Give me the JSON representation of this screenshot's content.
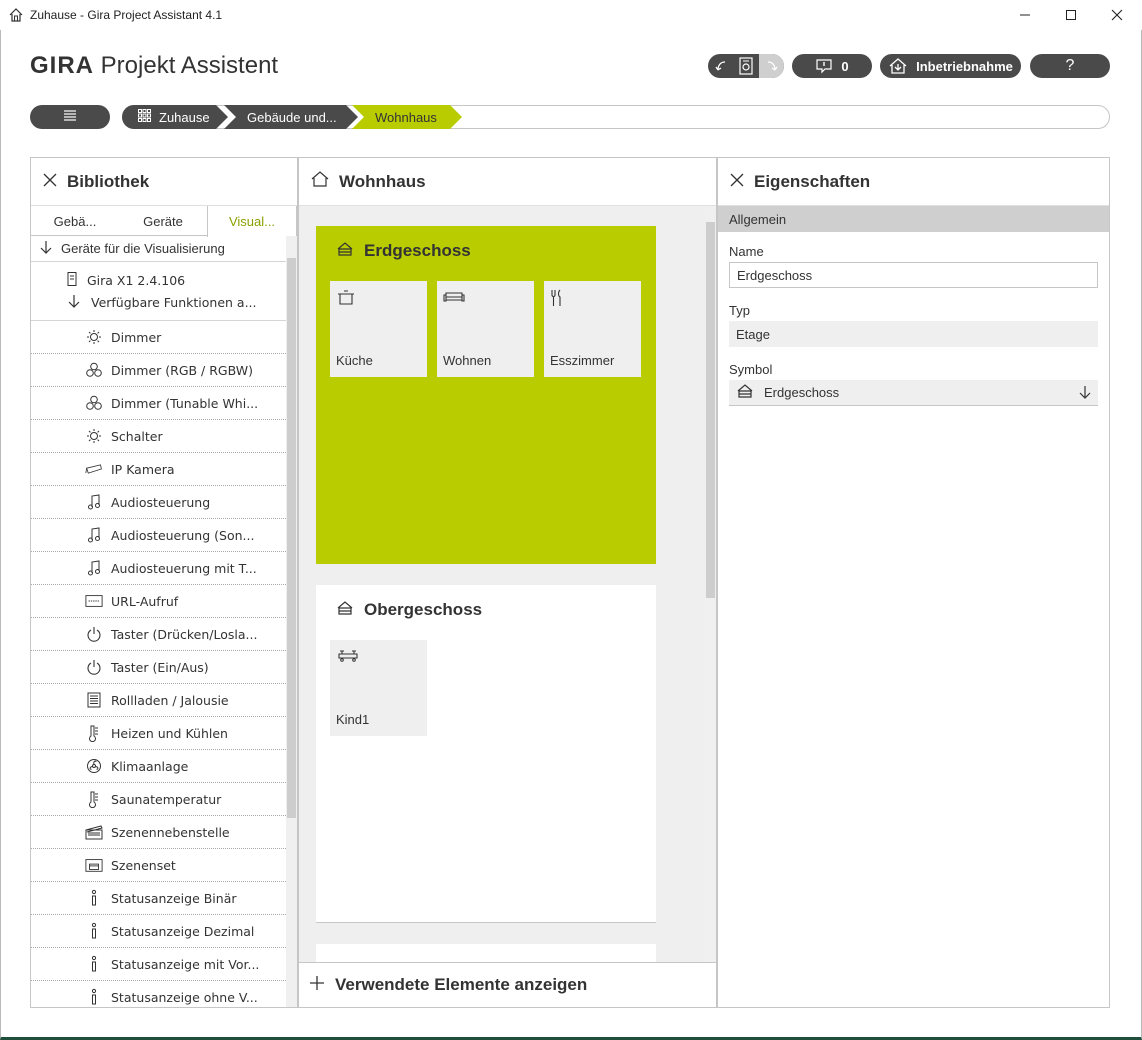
{
  "window": {
    "title": "Zuhause - Gira Project Assistant 4.1",
    "controls": [
      "minimize",
      "maximize",
      "close"
    ]
  },
  "brand": {
    "bold": "GIRA",
    "rest": "Projekt Assistent"
  },
  "toolbar": {
    "messages_count": "0",
    "commission_label": "Inbetriebnahme",
    "help_label": "?"
  },
  "breadcrumb": {
    "items": [
      "Zuhause",
      "Gebäude und...",
      "Wohnhaus"
    ]
  },
  "library": {
    "title": "Bibliothek",
    "tabs": [
      "Gebä...",
      "Geräte",
      "Visual..."
    ],
    "active_tab": "Visual...",
    "root_label": "Geräte für die Visualisierung",
    "device_name": "Gira X1 2.4.106",
    "device_sub": "Verfügbare Funktionen a...",
    "functions": [
      {
        "label": "Dimmer",
        "icon": "bulb-icon"
      },
      {
        "label": "Dimmer (RGB / RGBW)",
        "icon": "rgb-icon"
      },
      {
        "label": "Dimmer (Tunable Whi...",
        "icon": "rgb-icon"
      },
      {
        "label": "Schalter",
        "icon": "bulb-icon"
      },
      {
        "label": "IP Kamera",
        "icon": "camera-icon"
      },
      {
        "label": "Audiosteuerung",
        "icon": "music-icon"
      },
      {
        "label": "Audiosteuerung (Son...",
        "icon": "music-icon"
      },
      {
        "label": "Audiosteuerung mit T...",
        "icon": "music-icon"
      },
      {
        "label": "URL-Aufruf",
        "icon": "www-icon"
      },
      {
        "label": "Taster (Drücken/Losla...",
        "icon": "power-icon"
      },
      {
        "label": "Taster (Ein/Aus)",
        "icon": "power-icon"
      },
      {
        "label": "Rollladen / Jalousie",
        "icon": "blind-icon"
      },
      {
        "label": "Heizen und Kühlen",
        "icon": "thermometer-icon"
      },
      {
        "label": "Klimaanlage",
        "icon": "fan-icon"
      },
      {
        "label": "Saunatemperatur",
        "icon": "thermometer-icon"
      },
      {
        "label": "Szenennebenstelle",
        "icon": "clapper-icon"
      },
      {
        "label": "Szenenset",
        "icon": "sceneset-icon"
      },
      {
        "label": "Statusanzeige Binär",
        "icon": "info-icon"
      },
      {
        "label": "Statusanzeige Dezimal",
        "icon": "info-icon"
      },
      {
        "label": "Statusanzeige mit Vor...",
        "icon": "info-icon"
      },
      {
        "label": "Statusanzeige ohne V...",
        "icon": "info-icon"
      }
    ]
  },
  "center": {
    "title": "Wohnhaus",
    "floors": [
      {
        "name": "Erdgeschoss",
        "rooms": [
          {
            "name": "Küche",
            "icon": "pot-icon"
          },
          {
            "name": "Wohnen",
            "icon": "sofa-icon"
          },
          {
            "name": "Esszimmer",
            "icon": "cutlery-icon"
          }
        ]
      },
      {
        "name": "Obergeschoss",
        "rooms": [
          {
            "name": "Kind1",
            "icon": "toy-icon"
          }
        ]
      }
    ],
    "footer_label": "Verwendete Elemente anzeigen"
  },
  "properties": {
    "title": "Eigenschaften",
    "section": "Allgemein",
    "name_label": "Name",
    "name_value": "Erdgeschoss",
    "type_label": "Typ",
    "type_value": "Etage",
    "symbol_label": "Symbol",
    "symbol_value": "Erdgeschoss"
  },
  "colors": {
    "accent_green": "#b9cc00",
    "dark_pill": "#4a4a4a",
    "active_tab_text": "#8aa000"
  }
}
